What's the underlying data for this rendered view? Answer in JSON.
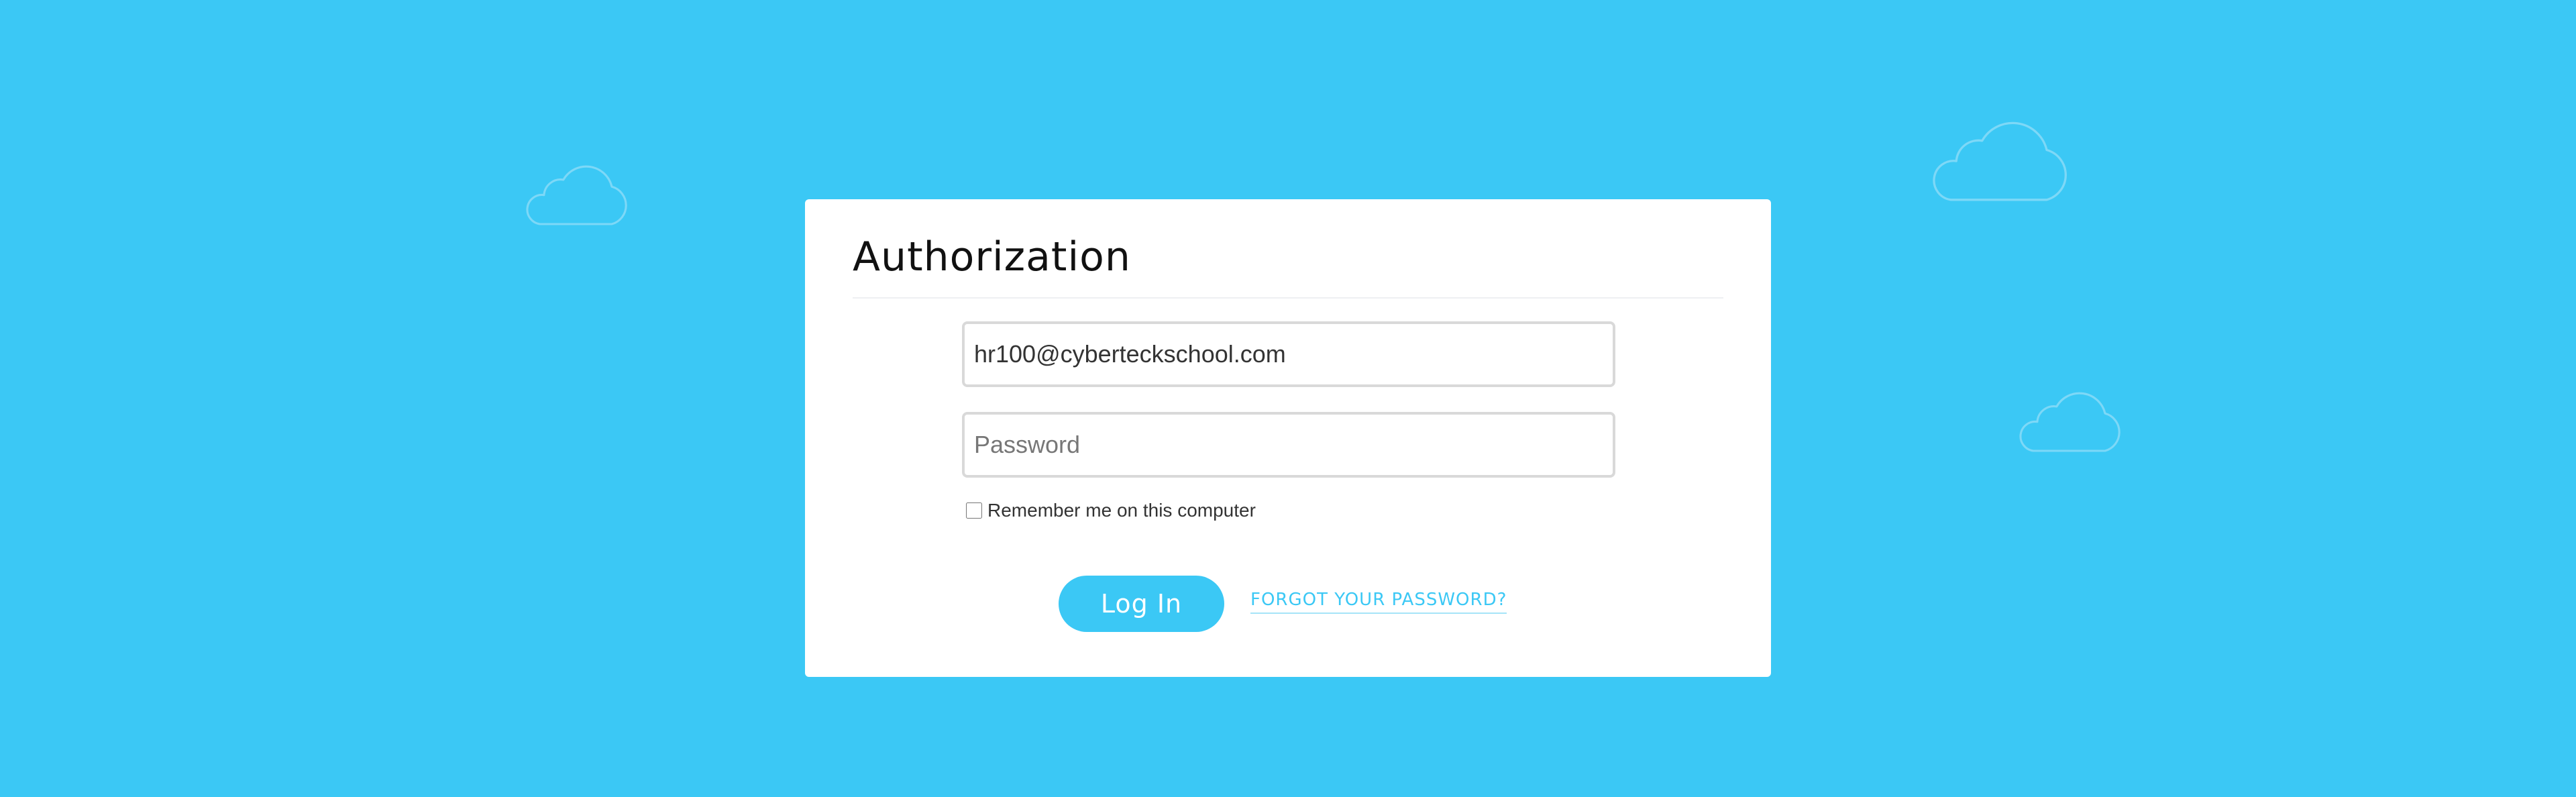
{
  "colors": {
    "background": "#3bc8f5",
    "card": "#ffffff",
    "accent": "#3bc8f5",
    "title_text": "#111111",
    "cloud_outline": "#7dd8f7"
  },
  "decorations": {
    "clouds": [
      "cloud-icon",
      "cloud-icon",
      "cloud-icon"
    ]
  },
  "auth": {
    "title": "Authorization",
    "login_field": {
      "value": "hr100@cyberteckschool.com",
      "placeholder": ""
    },
    "password_field": {
      "value": "",
      "placeholder": "Password"
    },
    "remember_me": {
      "label": "Remember me on this computer",
      "checked": false
    },
    "login_button": "Log In",
    "forgot_password_link": "FORGOT YOUR PASSWORD?"
  }
}
